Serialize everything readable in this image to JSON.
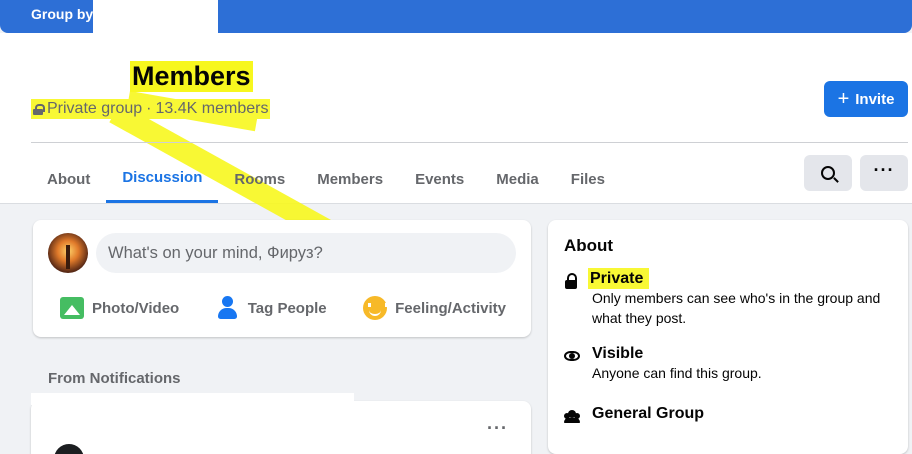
{
  "topbar": {
    "label": "Group by"
  },
  "header": {
    "title": "Members",
    "privacy": "Private group",
    "separator": "·",
    "member_count": "13.4K members",
    "invite_label": "Invite",
    "invite_icon": "plus-icon"
  },
  "tabs": [
    "About",
    "Discussion",
    "Rooms",
    "Members",
    "Events",
    "Media",
    "Files"
  ],
  "active_tab": "Discussion",
  "toolbar": {
    "search_icon": "search-icon",
    "more_label": "···"
  },
  "composer": {
    "placeholder": "What's on your mind, Фируз?",
    "actions": [
      "Photo/Video",
      "Tag People",
      "Feeling/Activity"
    ]
  },
  "feed": {
    "section_label": "From Notifications",
    "more_label": "···"
  },
  "about": {
    "title": "About",
    "private_title": "Private",
    "private_desc": "Only members can see who's in the group and what they post.",
    "visible_title": "Visible",
    "visible_desc": "Anyone can find this group.",
    "type_title": "General Group"
  },
  "colors": {
    "brand": "#1b74e4",
    "highlight": "#f8f835",
    "topbar": "#2d6fd6"
  }
}
